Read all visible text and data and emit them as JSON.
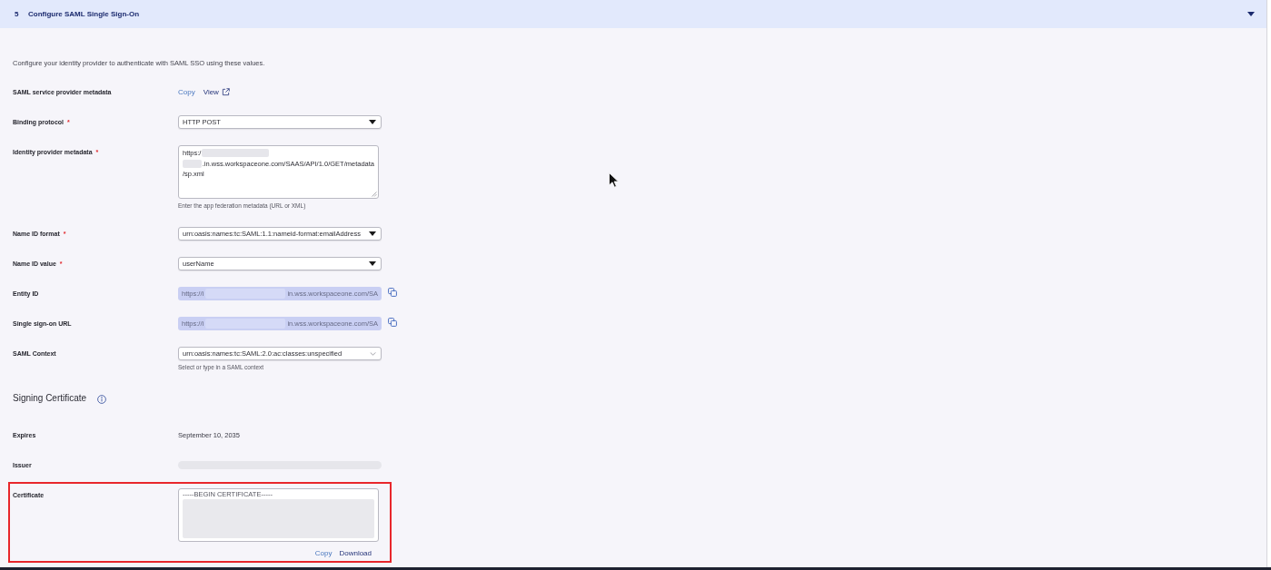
{
  "section": {
    "number": "5",
    "title": "Configure SAML Single Sign-On",
    "expanded": true
  },
  "description": "Configure your identity provider to authenticate with SAML SSO using these values.",
  "fields": [
    {
      "kind": "links",
      "label": "SAML service provider metadata",
      "links": [
        {
          "kind": "copy",
          "text": "Copy"
        },
        {
          "kind": "external",
          "text": "View"
        }
      ]
    },
    {
      "kind": "select",
      "label": "Binding protocol",
      "required_mark": "*",
      "value": "HTTP POST"
    },
    {
      "kind": "textarea",
      "label": "Identity provider metadata",
      "required_mark": "*",
      "lines": [
        [
          {
            "kind": "text",
            "text": "https:/"
          },
          {
            "kind": "redacted"
          }
        ],
        [
          {
            "kind": "redacted"
          },
          {
            "kind": "text",
            "text": ".in.wss.workspaceone.com/SAAS/API/1.0/GET/metadata"
          }
        ],
        [
          {
            "kind": "text",
            "text": "/sp.xml"
          }
        ]
      ],
      "helper": "Enter the app federation metadata (URL or XML)"
    },
    {
      "kind": "select",
      "label": "Name ID format",
      "required_mark": "*",
      "value": "urn:oasis:names:tc:SAML:1.1:nameid-format:emailAddress"
    },
    {
      "kind": "select",
      "label": "Name ID value",
      "required_mark": "*",
      "value": "userName"
    },
    {
      "kind": "readonly",
      "label": "Entity ID",
      "prefix": "https://i",
      "suffix": "in.wss.workspaceone.com/SA"
    },
    {
      "kind": "readonly",
      "label": "Single sign-on URL",
      "prefix": "https://i",
      "suffix": "in.wss.workspaceone.com/SA"
    },
    {
      "kind": "combobox",
      "label": "SAML Context",
      "value": "urn:oasis:names:tc:SAML:2.0:ac:classes:unspecified",
      "helper": "Select or type in a SAML context"
    }
  ],
  "signing_certificate": {
    "title": "Signing Certificate",
    "fields": [
      {
        "kind": "text",
        "label": "Expires",
        "value": "September 10, 2035"
      },
      {
        "kind": "redacted",
        "label": "Issuer"
      },
      {
        "kind": "certificate",
        "label": "Certificate",
        "highlighted": true,
        "first_line": "-----BEGIN CERTIFICATE-----",
        "actions": [
          {
            "kind": "copy",
            "text": "Copy"
          },
          {
            "kind": "download",
            "text": "Download"
          }
        ]
      }
    ]
  }
}
